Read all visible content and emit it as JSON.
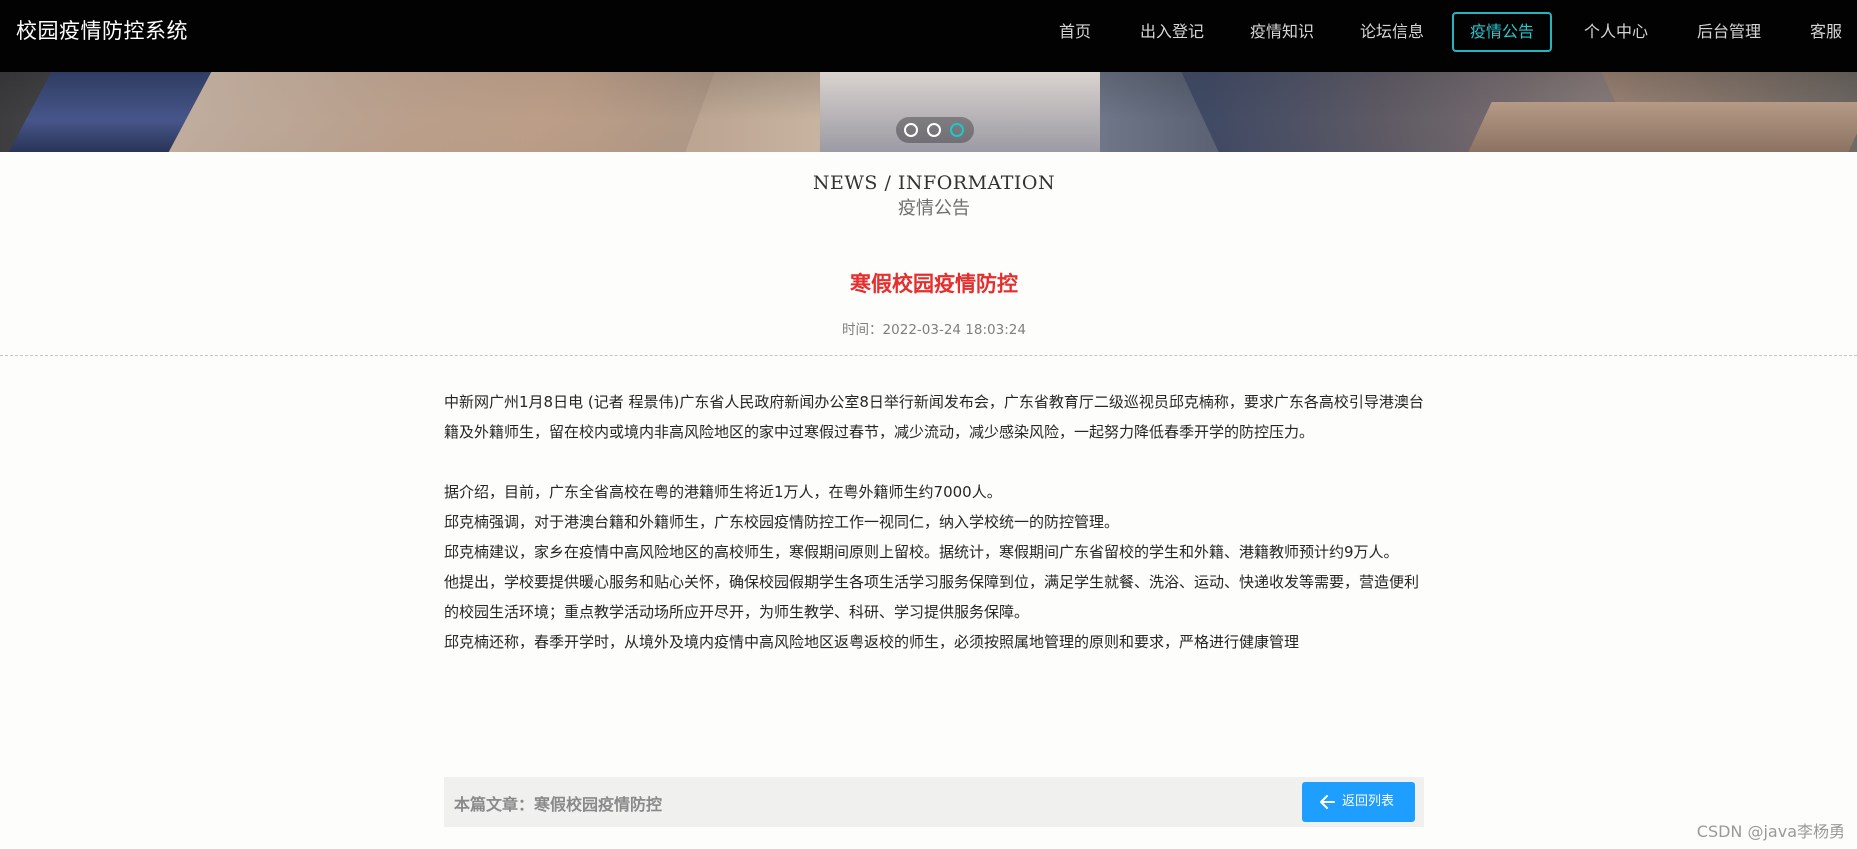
{
  "app": {
    "title": "校园疫情防控系统"
  },
  "nav": {
    "items": [
      {
        "label": "首页"
      },
      {
        "label": "出入登记"
      },
      {
        "label": "疫情知识"
      },
      {
        "label": "论坛信息"
      },
      {
        "label": "疫情公告",
        "active": true
      },
      {
        "label": "个人中心"
      },
      {
        "label": "后台管理"
      },
      {
        "label": "客服"
      }
    ],
    "active_color": "#21b6bd"
  },
  "carousel": {
    "slides": 3,
    "active_index": 3,
    "indicator_color": "#1cc8c9"
  },
  "section": {
    "en_title": "NEWS / INFORMATION",
    "cn_title": "疫情公告"
  },
  "article": {
    "title": "寒假校园疫情防控",
    "time": "时间：2022-03-24 18:03:24",
    "title_color": "#e62e2e",
    "paragraphs": {
      "p1": "中新网广州1月8日电 (记者 程景伟)广东省人民政府新闻办公室8日举行新闻发布会，广东省教育厅二级巡视员邱克楠称，要求广东各高校引导港澳台籍及外籍师生，留在校内或境内非高风险地区的家中过寒假过春节，减少流动，减少感染风险，一起努力降低春季开学的防控压力。",
      "p2": "据介绍，目前，广东全省高校在粤的港籍师生将近1万人，在粤外籍师生约7000人。",
      "p3": "邱克楠强调，对于港澳台籍和外籍师生，广东校园疫情防控工作一视同仁，纳入学校统一的防控管理。",
      "p4": "邱克楠建议，家乡在疫情中高风险地区的高校师生，寒假期间原则上留校。据统计，寒假期间广东省留校的学生和外籍、港籍教师预计约9万人。",
      "p5": "他提出，学校要提供暖心服务和贴心关怀，确保校园假期学生各项生活学习服务保障到位，满足学生就餐、洗浴、运动、快递收发等需要，营造便利的校园生活环境；重点教学活动场所应开尽开，为师生教学、科研、学习提供服务保障。",
      "p6": "邱克楠还称，春季开学时，从境外及境内疫情中高风险地区返粤返校的师生，必须按照属地管理的原则和要求，严格进行健康管理"
    }
  },
  "footer": {
    "label": "本篇文章：寒假校园疫情防控",
    "back_button": "返回列表",
    "back_icon": "arrow-left-icon",
    "button_color": "#1e9fff"
  },
  "watermark": "CSDN @java李杨勇"
}
